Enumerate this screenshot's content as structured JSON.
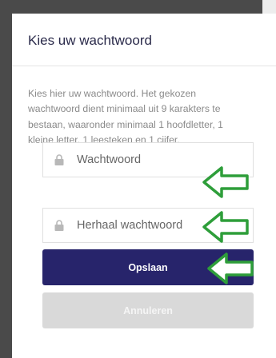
{
  "modal": {
    "title": "Kies uw wachtwoord",
    "description": "Kies hier uw wachtwoord. Het gekozen wachtwoord dient minimaal uit 9 karakters te bestaan, waaronder minimaal 1 hoofdletter, 1 kleine letter, 1 leesteken en 1 cijfer."
  },
  "form": {
    "password": {
      "placeholder": "Wachtwoord",
      "value": "",
      "icon": "lock-icon"
    },
    "repeat_password": {
      "placeholder": "Herhaal wachtwoord",
      "value": "",
      "icon": "lock-icon"
    },
    "save_label": "Opslaan",
    "cancel_label": "Annuleren"
  },
  "annotations": {
    "arrow_icon": "left-arrow-icon",
    "arrow_color": "#2e9e3a"
  },
  "colors": {
    "primary": "#27246b",
    "disabled": "#d9d9d9",
    "backdrop": "#4a4a4a"
  }
}
